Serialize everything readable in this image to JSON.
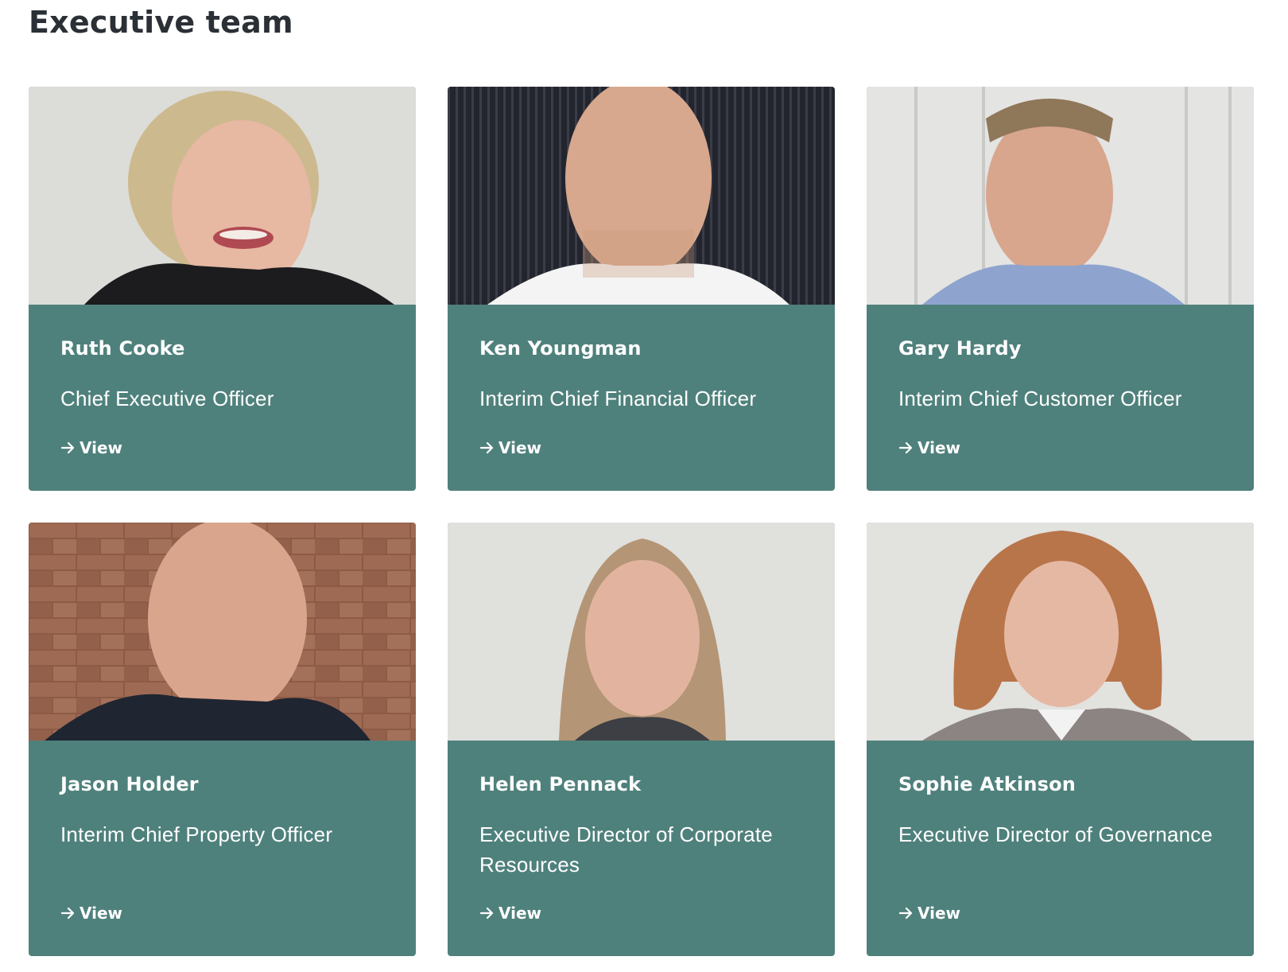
{
  "section": {
    "title": "Executive team"
  },
  "members": [
    {
      "name": "Ruth Cooke",
      "role": "Chief Executive Officer",
      "link_label": "View",
      "photo_alt": "Ruth Cooke"
    },
    {
      "name": "Ken Youngman",
      "role": "Interim Chief Financial Officer",
      "link_label": "View",
      "photo_alt": "Ken Youngman"
    },
    {
      "name": "Gary Hardy",
      "role": "Interim Chief Customer Officer",
      "link_label": "View",
      "photo_alt": "Gary Hardy"
    },
    {
      "name": "Jason Holder",
      "role": "Interim Chief Property Officer",
      "link_label": "View",
      "photo_alt": "Jason Holder"
    },
    {
      "name": "Helen Pennack",
      "role": "Executive Director of Corporate Resources",
      "link_label": "View",
      "photo_alt": "Helen Pennack"
    },
    {
      "name": "Sophie Atkinson",
      "role": "Executive Director of Governance",
      "link_label": "View",
      "photo_alt": "Sophie Atkinson"
    }
  ],
  "colors": {
    "card_background": "#4f817c",
    "card_text": "#ffffff",
    "title_text": "#2b3036"
  },
  "icons": {
    "link_icon": "arrow-right-icon"
  }
}
